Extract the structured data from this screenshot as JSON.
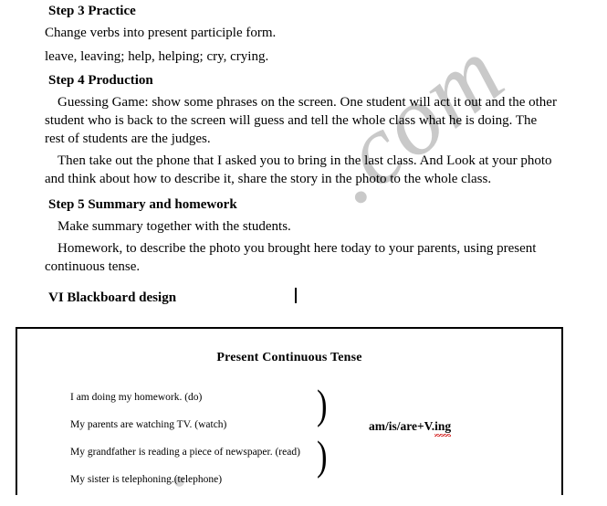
{
  "document": {
    "watermark": ".com",
    "watermark_secondary": "."
  },
  "steps": [
    {
      "heading": "Step 3 Practice",
      "lines": [
        "Change verbs into present participle form.",
        "leave, leaving;    help, helping;    cry, crying."
      ]
    },
    {
      "heading": "Step 4 Production",
      "lines": [
        "Guessing Game: show some phrases on the screen. One student will act it out and the other student who is back to the screen will guess and tell the whole class what he is doing. The rest of students are the judges.",
        "Then take out the phone that I asked you to bring in the last class. And Look at your photo and think about how to describe it, share the story in the photo to the whole class."
      ]
    },
    {
      "heading": "Step 5 Summary and homework",
      "lines": [
        "Make summary together with the students.",
        "Homework, to describe the photo you brought here today to your parents, using present continuous tense."
      ]
    }
  ],
  "blackboard_section": {
    "heading": "VI Blackboard design",
    "board_title": "Present Continuous Tense",
    "sentences": [
      "I am doing my homework. (do)",
      "My parents are watching TV. (watch)",
      "My grandfather is reading a piece of newspaper. (read)",
      "My sister is telephoning.(telephone)"
    ],
    "brace_top_glyph": ")",
    "brace_bottom_glyph": ")",
    "formula_prefix": "am/is/are+V.",
    "formula_misspelled": "ing"
  }
}
